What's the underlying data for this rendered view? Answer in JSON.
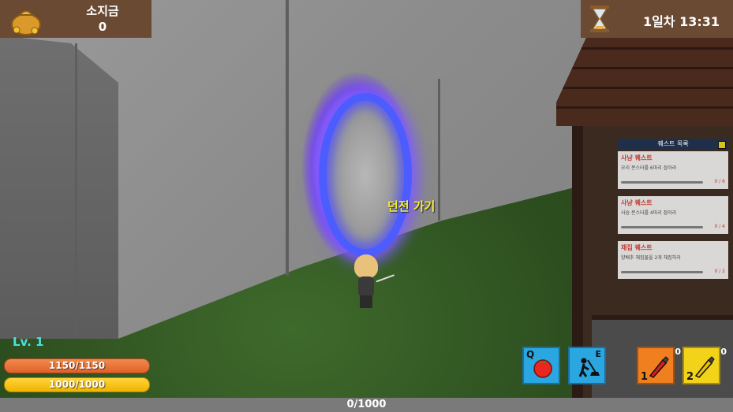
{
  "money": {
    "title": "소지금",
    "value": "0",
    "icon": "gold-pouch-icon"
  },
  "time": {
    "text": "1일차 13:31",
    "icon": "hourglass-icon"
  },
  "portal": {
    "label": "던전 가기"
  },
  "quests": {
    "header": "퀘스트 목록",
    "items": [
      {
        "title": "사냥 퀘스트",
        "desc": "오리 몬스터를 6마리 잡아라",
        "progress": "0 / 6",
        "fraction": 0.0
      },
      {
        "title": "사냥 퀘스트",
        "desc": "사슴 몬스터를 4마리 잡아라",
        "progress": "0 / 4",
        "fraction": 0.0
      },
      {
        "title": "채집 퀘스트",
        "desc": "양배추 채집물을 2개 채집하라",
        "progress": "0 / 2",
        "fraction": 0.0
      }
    ]
  },
  "player": {
    "level": "Lv.   1",
    "hp": "1150/1150",
    "mp": "1000/1000",
    "exp": "0/1000"
  },
  "skills": [
    {
      "key": "Q",
      "icon": "tomato-icon",
      "color": "#2aa6e0"
    },
    {
      "key": "E",
      "icon": "dig-shovel-icon",
      "color": "#2aa6e0"
    },
    {
      "slot": "1",
      "count": "0",
      "icon": "red-potion-icon",
      "color": "#f07f1f"
    },
    {
      "slot": "2",
      "count": "0",
      "icon": "yellow-potion-icon",
      "color": "#f3d21a"
    }
  ]
}
